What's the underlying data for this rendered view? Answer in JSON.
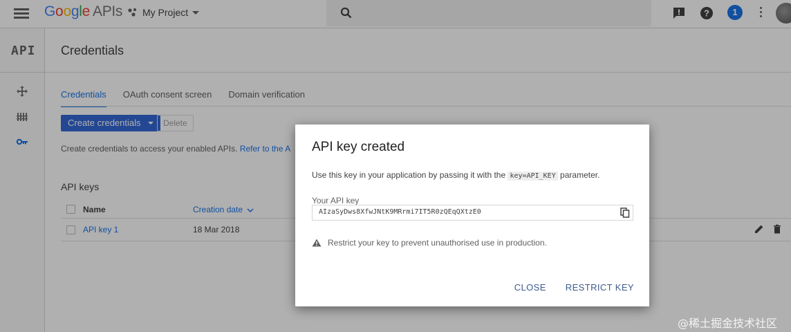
{
  "topbar": {
    "logo_google": [
      "G",
      "o",
      "o",
      "g",
      "l",
      "e"
    ],
    "logo_apis": "APIs",
    "project_name": "My Project",
    "notification_count": "1"
  },
  "rail": {
    "api_logo": "API",
    "items": [
      "dashboard-icon",
      "library-icon",
      "credentials-key-icon"
    ]
  },
  "main": {
    "page_title": "Credentials",
    "tabs": [
      {
        "label": "Credentials",
        "active": true
      },
      {
        "label": "OAuth consent screen",
        "active": false
      },
      {
        "label": "Domain verification",
        "active": false
      }
    ],
    "create_button": "Create credentials",
    "delete_button": "Delete",
    "description": "Create credentials to access your enabled APIs.",
    "description_link": "Refer to the A",
    "section_title": "API keys",
    "table": {
      "columns": [
        "Name",
        "Creation date"
      ],
      "rows": [
        {
          "name": "API key 1",
          "creation_date": "18 Mar 2018"
        }
      ]
    }
  },
  "dialog": {
    "title": "API key created",
    "text_before": "Use this key in your application by passing it with the ",
    "text_code": "key=API_KEY",
    "text_after": " parameter.",
    "key_label": "Your API key",
    "key_value": "AIzaSyDws8XfwJNtK9MRrmi7IT5R0zQEqQXtzE0",
    "warning": "Restrict your key to prevent unauthorised use in production.",
    "close_button": "CLOSE",
    "restrict_button": "RESTRICT KEY"
  },
  "watermark": "@稀土掘金技术社区",
  "colors": {
    "accent": "#1a73e8",
    "primary_button": "#3367d6",
    "dialog_action": "#3c5a8c"
  }
}
